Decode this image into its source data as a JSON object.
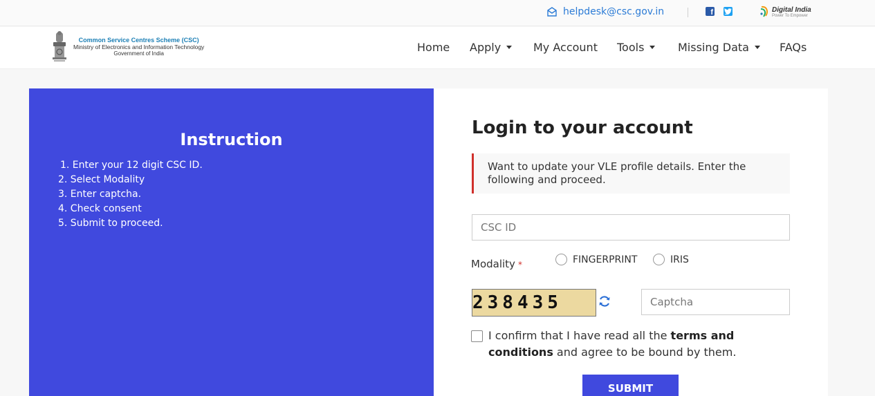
{
  "topbar": {
    "email": "helpdesk@csc.gov.in",
    "icons": [
      "mail-icon",
      "facebook-icon",
      "twitter-icon",
      "digital-india-logo"
    ],
    "digital_india": {
      "title": "Digital India",
      "tagline": "Power To Empower"
    }
  },
  "brand": {
    "line1": "Common Service Centres Scheme (CSC)",
    "line2": "Ministry of Electronics and Information Technology",
    "line3": "Government of India"
  },
  "nav": {
    "items": [
      {
        "label": "Home",
        "dropdown": false
      },
      {
        "label": "Apply",
        "dropdown": true
      },
      {
        "label": "My Account",
        "dropdown": false
      },
      {
        "label": "Tools",
        "dropdown": true
      },
      {
        "label": "Missing Data",
        "dropdown": true
      },
      {
        "label": "FAQs",
        "dropdown": false
      }
    ]
  },
  "instruction": {
    "title": "Instruction",
    "steps": [
      "1. Enter your 12 digit CSC ID.",
      "2. Select Modality",
      "3. Enter captcha.",
      "4. Check consent",
      "5. Submit to proceed."
    ]
  },
  "login": {
    "title": "Login to your account",
    "notice": "Want to update your VLE profile details. Enter the following and proceed.",
    "csc_id_placeholder": "CSC ID",
    "csc_id_value": "",
    "modality_label": "Modality",
    "required_marker": "*",
    "modality_options": [
      "FINGERPRINT",
      "IRIS"
    ],
    "captcha_text": "238435",
    "captcha_placeholder": "Captcha",
    "consent_prefix": "I confirm that I have read all the ",
    "consent_link": "terms and conditions",
    "consent_suffix": " and agree to be bound by them.",
    "submit_label": "SUBMIT"
  },
  "colors": {
    "accent": "#4049de",
    "link": "#2b7bd6",
    "notice_border": "#d0302b",
    "captcha_bg": "#ecd9a0"
  }
}
